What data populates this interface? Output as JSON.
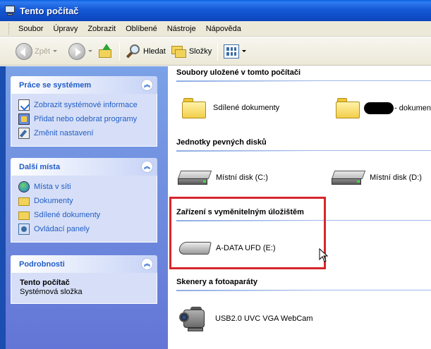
{
  "window": {
    "title": "Tento počítač"
  },
  "menu": [
    "Soubor",
    "Úpravy",
    "Zobrazit",
    "Oblíbené",
    "Nástroje",
    "Nápověda"
  ],
  "toolbar": {
    "back_label": "Zpět",
    "search_label": "Hledat",
    "folders_label": "Složky"
  },
  "sidebar": {
    "system_tasks": {
      "title": "Práce se systémem",
      "items": [
        "Zobrazit systémové informace",
        "Přidat nebo odebrat programy",
        "Změnit nastavení"
      ]
    },
    "other_places": {
      "title": "Další místa",
      "items": [
        "Místa v síti",
        "Dokumenty",
        "Sdílené dokumenty",
        "Ovládací panely"
      ]
    },
    "details": {
      "title": "Podrobnosti",
      "name": "Tento počítač",
      "type": "Systémová složka"
    }
  },
  "groups": {
    "stored_files": {
      "title": "Soubory uložené v tomto počítači",
      "items": [
        "Sdílené dokumenty",
        "- dokumenty"
      ]
    },
    "hard_drives": {
      "title": "Jednotky pevných disků",
      "items": [
        "Místní disk (C:)",
        "Místní disk (D:)"
      ]
    },
    "removable": {
      "title": "Zařízení s vyměnitelným úložištěm",
      "items": [
        "A-DATA UFD (E:)"
      ]
    },
    "scanners": {
      "title": "Skenery a fotoaparáty",
      "items": [
        "USB2.0 UVC VGA WebCam"
      ]
    }
  },
  "colors": {
    "titlebar": "#0f4cc6",
    "task_link": "#215dc6",
    "highlight": "#d6262c",
    "sidebar": "#6c8ee0"
  }
}
